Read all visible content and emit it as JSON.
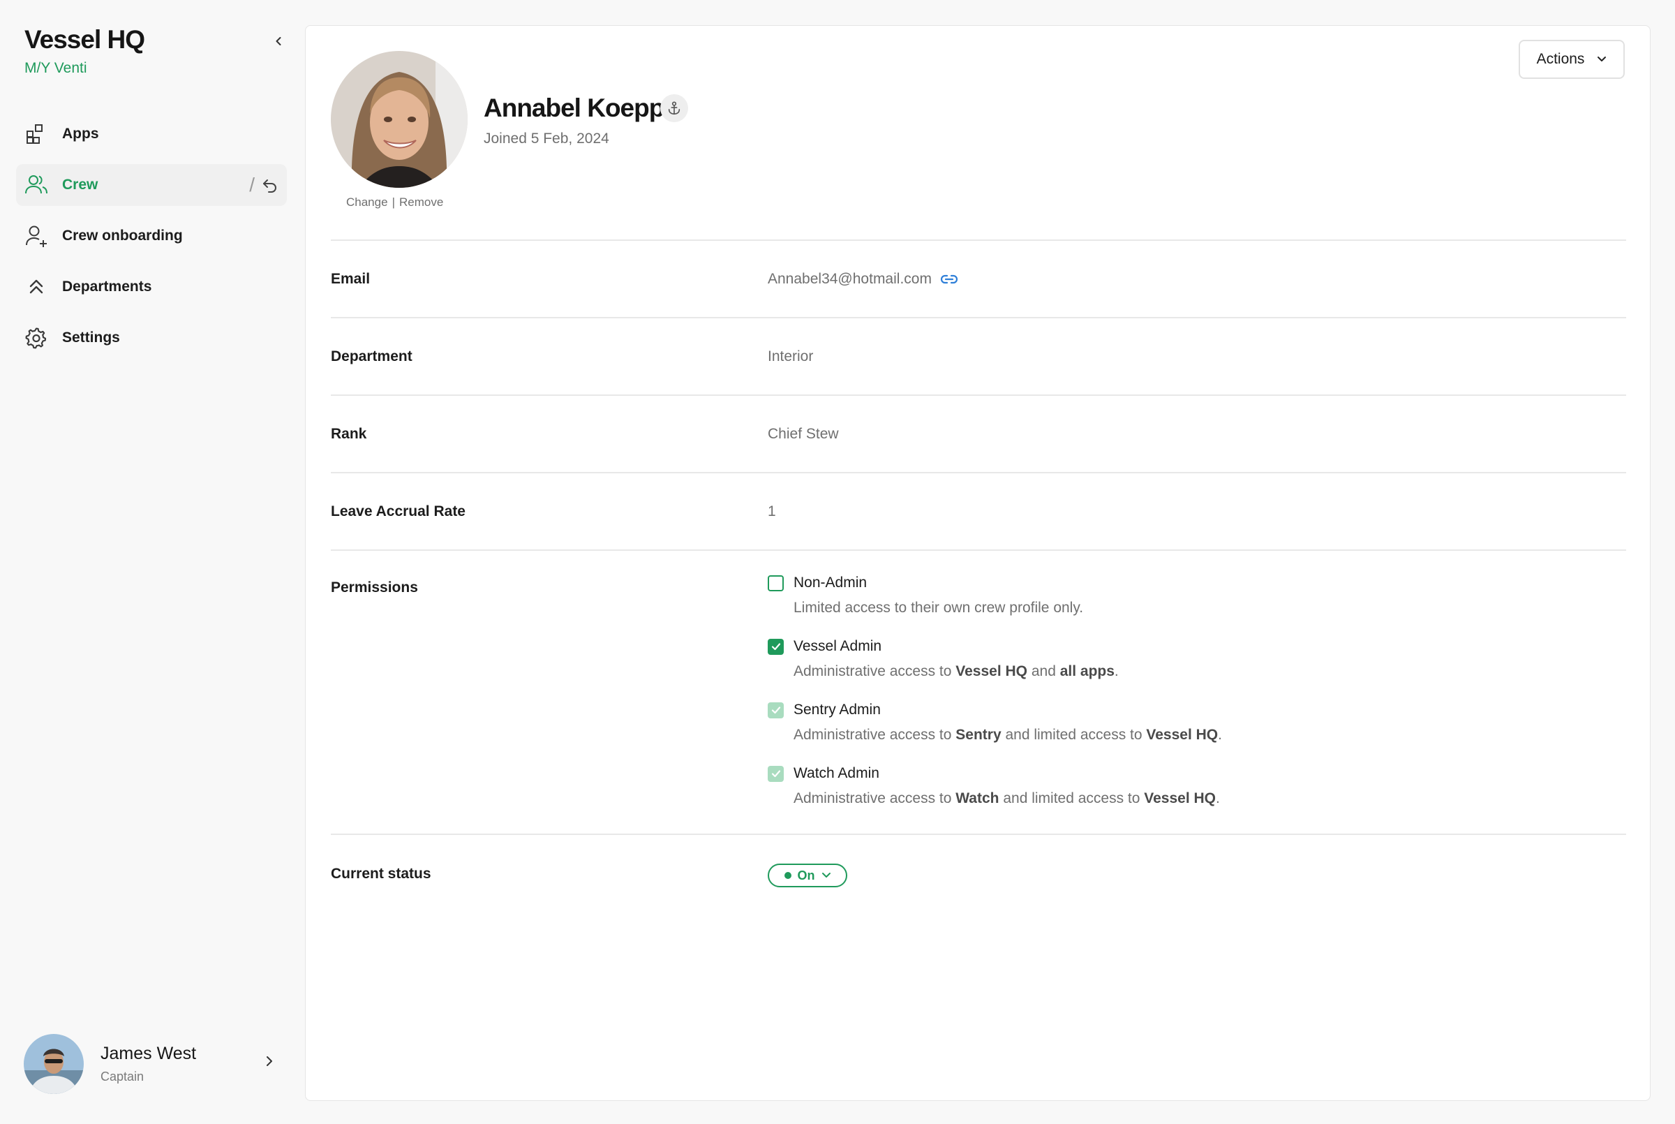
{
  "app": {
    "title": "Vessel HQ",
    "vessel": "M/Y Venti"
  },
  "sidebar": {
    "items": [
      {
        "label": "Apps",
        "icon": "apps-icon"
      },
      {
        "label": "Crew",
        "icon": "crew-icon",
        "active": true
      },
      {
        "label": "Crew onboarding",
        "icon": "user-add-icon"
      },
      {
        "label": "Departments",
        "icon": "chevrons-up-icon"
      },
      {
        "label": "Settings",
        "icon": "gear-icon"
      }
    ],
    "crew_separator": "/"
  },
  "user": {
    "name": "James West",
    "role": "Captain"
  },
  "toolbar": {
    "actions_label": "Actions"
  },
  "profile": {
    "name": "Annabel Koepp",
    "joined": "Joined 5 Feb, 2024",
    "photo_change": "Change",
    "photo_separator": "|",
    "photo_remove": "Remove"
  },
  "fields": {
    "email": {
      "label": "Email",
      "value": "Annabel34@hotmail.com"
    },
    "department": {
      "label": "Department",
      "value": "Interior"
    },
    "rank": {
      "label": "Rank",
      "value": "Chief Stew"
    },
    "leave": {
      "label": "Leave Accrual Rate",
      "value": "1"
    },
    "permissions": {
      "label": "Permissions"
    },
    "status": {
      "label": "Current status",
      "value": "On"
    }
  },
  "permissions": [
    {
      "title": "Non-Admin",
      "state": "unchecked",
      "desc": [
        {
          "t": "Limited access to their own crew profile only."
        }
      ]
    },
    {
      "title": "Vessel Admin",
      "state": "checked",
      "desc": [
        {
          "t": "Administrative access to "
        },
        {
          "t": "Vessel HQ",
          "b": true
        },
        {
          "t": " and "
        },
        {
          "t": "all apps",
          "b": true
        },
        {
          "t": "."
        }
      ]
    },
    {
      "title": "Sentry Admin",
      "state": "checked-disabled",
      "desc": [
        {
          "t": "Administrative access to "
        },
        {
          "t": "Sentry",
          "b": true
        },
        {
          "t": " and limited access to "
        },
        {
          "t": "Vessel HQ",
          "b": true
        },
        {
          "t": "."
        }
      ]
    },
    {
      "title": "Watch Admin",
      "state": "checked-disabled",
      "desc": [
        {
          "t": "Administrative access to "
        },
        {
          "t": "Watch",
          "b": true
        },
        {
          "t": " and limited access to "
        },
        {
          "t": "Vessel HQ",
          "b": true
        },
        {
          "t": "."
        }
      ]
    }
  ],
  "colors": {
    "accent": "#1f9a5b",
    "link": "#2f7fd8"
  }
}
